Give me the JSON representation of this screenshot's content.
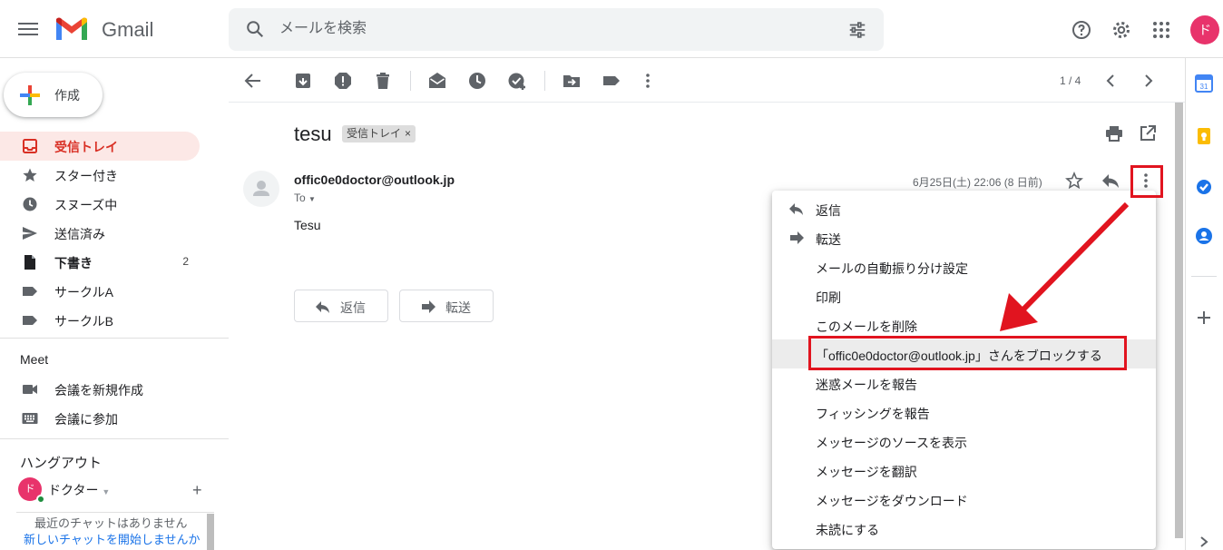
{
  "header": {
    "brand": "Gmail",
    "search_placeholder": "メールを検索",
    "avatar_letter": "ド"
  },
  "sidebar": {
    "compose_label": "作成",
    "items": [
      {
        "label": "受信トレイ",
        "count": ""
      },
      {
        "label": "スター付き",
        "count": ""
      },
      {
        "label": "スヌーズ中",
        "count": ""
      },
      {
        "label": "送信済み",
        "count": ""
      },
      {
        "label": "下書き",
        "count": "2"
      },
      {
        "label": "サークルA",
        "count": ""
      },
      {
        "label": "サークルB",
        "count": ""
      }
    ],
    "meet_title": "Meet",
    "meet_items": [
      "会議を新規作成",
      "会議に参加"
    ],
    "hangouts_title": "ハングアウト",
    "hangouts_user": "ドクター",
    "hangouts_avatar": "ド",
    "chat_empty": "最近のチャットはありません",
    "chat_link": "新しいチャットを開始しませんか"
  },
  "toolbar": {
    "pager": "1 / 4"
  },
  "message": {
    "subject": "tesu",
    "label_chip": "受信トレイ",
    "label_chip_close": "×",
    "sender": "offic0e0doctor@outlook.jp",
    "to": "To",
    "date": "6月25日(土) 22:06 (8 日前)",
    "body": "Tesu",
    "reply_label": "返信",
    "forward_label": "転送"
  },
  "menu": {
    "items": [
      "返信",
      "転送",
      "メールの自動振り分け設定",
      "印刷",
      "このメールを削除",
      "「offic0e0doctor@outlook.jp」さんをブロックする",
      "迷惑メールを報告",
      "フィッシングを報告",
      "メッセージのソースを表示",
      "メッセージを翻訳",
      "メッセージをダウンロード",
      "未読にする"
    ]
  },
  "colors": {
    "accent_red": "#e1141f",
    "active_nav_bg": "#fce8e6",
    "active_nav_text": "#d93025"
  }
}
